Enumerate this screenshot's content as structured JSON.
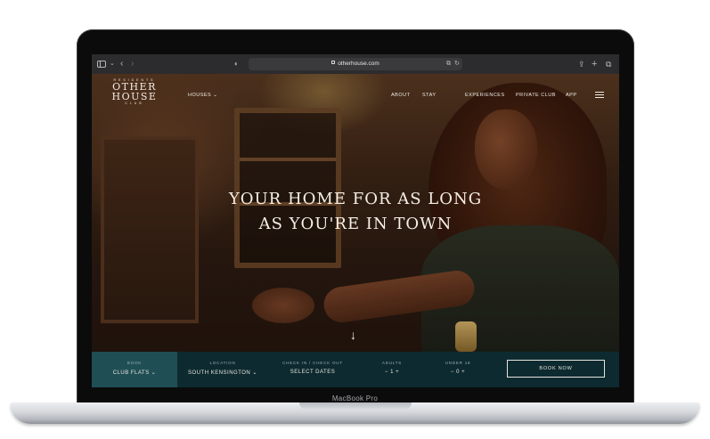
{
  "browser": {
    "url": "otherhouse.com"
  },
  "brand": {
    "top": "RESIDENTS",
    "line1": "OTHER",
    "line2": "HOUSE",
    "bottom": "CLUB"
  },
  "nav": {
    "houses": "HOUSES ⌄",
    "items": [
      "ABOUT",
      "STAY",
      "EXPERIENCES",
      "PRIVATE CLUB",
      "APP"
    ]
  },
  "hero": {
    "headline_line1": "YOUR HOME FOR AS LONG",
    "headline_line2": "AS YOU'RE IN TOWN"
  },
  "booking": {
    "book_label": "BOOK",
    "book_value": "CLUB FLATS ⌄",
    "location_label": "LOCATION",
    "location_value": "SOUTH KENSINGTON ⌄",
    "dates_label": "CHECK IN / CHECK OUT",
    "dates_value": "SELECT DATES",
    "adults_label": "ADULTS",
    "adults_value": "−  1  +",
    "under_label": "UNDER 18",
    "under_value": "−  0  +",
    "cta": "BOOK NOW"
  },
  "device": {
    "label": "MacBook Pro"
  }
}
